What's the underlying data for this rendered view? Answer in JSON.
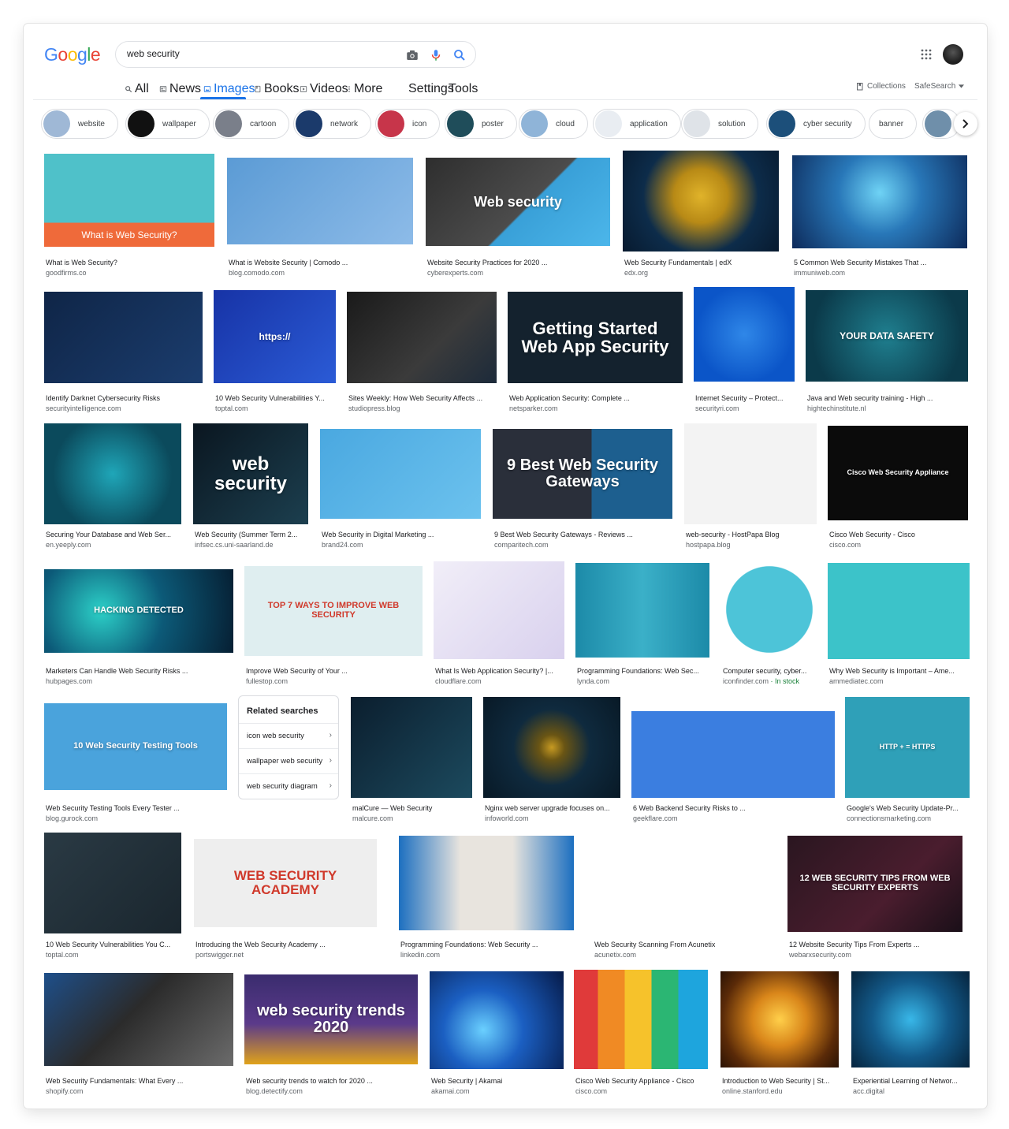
{
  "logo": {
    "letters": [
      "G",
      "o",
      "o",
      "g",
      "l",
      "e"
    ],
    "colors": [
      "#4285f4",
      "#ea4335",
      "#fbbc05",
      "#4285f4",
      "#34a853",
      "#ea4335"
    ]
  },
  "search": {
    "query": "web security",
    "camera_icon": "camera-icon",
    "mic_icon": "mic-icon",
    "search_icon": "search-icon"
  },
  "tabs": [
    {
      "label": "All",
      "icon": "search-icon"
    },
    {
      "label": "News",
      "icon": "news-icon"
    },
    {
      "label": "Images",
      "icon": "image-icon",
      "active": true
    },
    {
      "label": "Books",
      "icon": "book-icon"
    },
    {
      "label": "Videos",
      "icon": "video-icon"
    },
    {
      "label": "More",
      "icon": "more-vert-icon"
    },
    {
      "label": "Settings"
    },
    {
      "label": "Tools"
    }
  ],
  "right_links": {
    "collections": "Collections",
    "safesearch": "SafeSearch"
  },
  "chips": [
    {
      "label": "website",
      "color": "#9fb8d6"
    },
    {
      "label": "wallpaper",
      "color": "#111111"
    },
    {
      "label": "cartoon",
      "color": "#7a7f8a"
    },
    {
      "label": "network",
      "color": "#1b3a6b"
    },
    {
      "label": "icon",
      "color": "#c7354a"
    },
    {
      "label": "poster",
      "color": "#1f4d5a"
    },
    {
      "label": "cloud",
      "color": "#8fb4d8"
    },
    {
      "label": "application",
      "color": "#e9edf2"
    },
    {
      "label": "solution",
      "color": "#dfe3e8"
    },
    {
      "label": "cyber security",
      "color": "#1c4f7a"
    },
    {
      "label": "banner",
      "color": "#ffffff"
    },
    {
      "label": "",
      "color": "#6f8faa"
    }
  ],
  "results": [
    {
      "caption": "What is Web Security?",
      "source": "goodfirms.co",
      "text": "What is Web Security?",
      "bg": "linear-gradient(180deg,#4fc1c9 0%,#4fc1c9 74%,#ef6a3a 74%,#ef6a3a 100%)"
    },
    {
      "caption": "What is Website Security | Comodo ...",
      "source": "blog.comodo.com",
      "text": "",
      "bg": "linear-gradient(135deg,#5b9bd5,#8dbbe8)"
    },
    {
      "caption": "Website Security Practices for 2020 ...",
      "source": "cyberexperts.com",
      "text": "Web security",
      "bg": "linear-gradient(135deg,#2e2e2e,#4c4c4c 55%,#39a0d8 56%,#4cb6ea 100%)"
    },
    {
      "caption": "Web Security Fundamentals | edX",
      "source": "edx.org",
      "text": "",
      "bg": "radial-gradient(circle at 50% 45%,#e0b32a 0,#b88a16 28%,#0d2c4a 60%,#071a2f 100%)"
    },
    {
      "caption": "5 Common Web Security Mistakes That ...",
      "source": "immuniweb.com",
      "text": "",
      "bg": "radial-gradient(circle at 50% 40%,#6fd3f5 0,#2877b8 40%,#0d2a5a 100%)"
    },
    {
      "caption": "Identify Darknet Cybersecurity Risks",
      "source": "securityintelligence.com",
      "text": "",
      "bg": "linear-gradient(135deg,#0f2547,#1b3d6e)"
    },
    {
      "caption": "10 Web Security Vulnerabilities Y...",
      "source": "toptal.com",
      "text": "https://",
      "bg": "linear-gradient(135deg,#1733a6,#2b5bd6)"
    },
    {
      "caption": "Sites Weekly: How Web Security Affects ...",
      "source": "studiopress.blog",
      "text": "",
      "bg": "linear-gradient(135deg,#1a1a1a,#3b3b3b 60%,#1c2a3a)"
    },
    {
      "caption": "Web Application Security: Complete ...",
      "source": "netsparker.com",
      "text": "Getting Started Web App Security",
      "bg": "#14222e"
    },
    {
      "caption": "Internet Security – Protect...",
      "source": "securityri.com",
      "text": "",
      "bg": "radial-gradient(circle,#2f87e8 0,#0b55c8 70%)"
    },
    {
      "caption": "Java and Web security training - High ...",
      "source": "hightechinstitute.nl",
      "text": "YOUR DATA SAFETY",
      "bg": "radial-gradient(circle,#1f7f8f 0,#0b3a4a 80%)"
    },
    {
      "caption": "Securing Your Database and Web Ser...",
      "source": "en.yeeply.com",
      "text": "",
      "bg": "radial-gradient(circle,#1fa6b8 0,#0b4a5c 70%)"
    },
    {
      "caption": "Web Security (Summer Term 2...",
      "source": "infsec.cs.uni-saarland.de",
      "text": "web security",
      "bg": "linear-gradient(135deg,#0a1620,#1c3f4f)"
    },
    {
      "caption": "Web Security in Digital Marketing ...",
      "source": "brand24.com",
      "text": "",
      "bg": "linear-gradient(135deg,#4aa8e0,#6cc2ee)"
    },
    {
      "caption": "9 Best Web Security Gateways - Reviews ...",
      "source": "comparitech.com",
      "text": "9 Best Web Security Gateways",
      "bg": "linear-gradient(90deg,#2a2f3a 0,#2a2f3a 55%,#1d5f8f 55%,#1d5f8f 100%)"
    },
    {
      "caption": "web-security - HostPapa Blog",
      "source": "hostpapa.blog",
      "text": "",
      "bg": "#f3f3f3"
    },
    {
      "caption": "Cisco Web Security - Cisco",
      "source": "cisco.com",
      "text": "Cisco Web Security Appliance",
      "bg": "#0b0b0b"
    },
    {
      "caption": "Marketers Can Handle Web Security Risks ...",
      "source": "hubpages.com",
      "text": "HACKING DETECTED",
      "bg": "radial-gradient(circle at 30% 50%,#2cd0c8 0,#0c5a78 45%,#061f33 100%)"
    },
    {
      "caption": "Improve Web Security of Your ...",
      "source": "fullestop.com",
      "text": "TOP 7 WAYS TO IMPROVE WEB SECURITY",
      "bg": "#dfeef0"
    },
    {
      "caption": "What Is Web Application Security? |...",
      "source": "cloudflare.com",
      "text": "",
      "bg": "linear-gradient(135deg,#f1eef8,#d9d1ee)"
    },
    {
      "caption": "Programming Foundations: Web Sec...",
      "source": "lynda.com",
      "text": "",
      "bg": "linear-gradient(90deg,#1c8aa8,#3bb0c8 50%,#1c8aa8)"
    },
    {
      "caption": "Computer security, cyber...",
      "source": "iconfinder.com",
      "stock": " · In stock",
      "text": "",
      "bg": "radial-gradient(circle,#4dc4d8 0,#4dc4d8 62%,#ffffff 63%)"
    },
    {
      "caption": "Why Web Security is Important – Ame...",
      "source": "ammediatec.com",
      "text": "",
      "bg": "#3cc3c9"
    },
    {
      "caption": "Web Security Testing Tools Every Tester ...",
      "source": "blog.gurock.com",
      "text": "10 Web Security Testing Tools",
      "bg": "#4aa3dc"
    },
    {
      "caption": "malCure — Web Security",
      "source": "malcure.com",
      "text": "",
      "bg": "linear-gradient(135deg,#0b1e2e,#1c4a5e)"
    },
    {
      "caption": "Nginx web server upgrade focuses on...",
      "source": "infoworld.com",
      "text": "",
      "bg": "radial-gradient(circle,#c79a22 0,#6a5514 15%,#0f2a3e 45%,#081926 100%)"
    },
    {
      "caption": "6 Web Backend Security Risks to ...",
      "source": "geekflare.com",
      "text": "",
      "bg": "#3b7ee0"
    },
    {
      "caption": "Google's Web Security Update-Pr...",
      "source": "connectionsmarketing.com",
      "text": "HTTP + = HTTPS",
      "bg": "#2fa0b8"
    },
    {
      "caption": "10 Web Security Vulnerabilities You C...",
      "source": "toptal.com",
      "text": "",
      "bg": "linear-gradient(135deg,#2a3a44,#1a262e)"
    },
    {
      "caption": "Introducing the Web Security Academy ...",
      "source": "portswigger.net",
      "text": "WEB SECURITY ACADEMY",
      "bg": "#eeeeee"
    },
    {
      "caption": "Programming Foundations: Web Security ...",
      "source": "linkedin.com",
      "text": "",
      "bg": "linear-gradient(90deg,#1c6fc0,#e8e4de 35%,#e8e4de 65%,#1c6fc0)"
    },
    {
      "caption": "Web Security Scanning From Acunetix",
      "source": "acunetix.com",
      "text": "",
      "bg": "#ffffff"
    },
    {
      "caption": "12 Website Security Tips From Experts ...",
      "source": "webarxsecurity.com",
      "text": "12 WEB SECURITY TIPS FROM WEB SECURITY EXPERTS",
      "bg": "linear-gradient(135deg,#2a1620,#4a1d2e 60%,#1a0f18)"
    },
    {
      "caption": "Web Security Fundamentals: What Every ...",
      "source": "shopify.com",
      "text": "",
      "bg": "linear-gradient(135deg,#1e4f8a,#2b2b2b 45%,#6b6b6b)"
    },
    {
      "caption": "Web security trends to watch for 2020 ...",
      "source": "blog.detectify.com",
      "text": "web security trends 2020",
      "bg": "linear-gradient(180deg,#3a2c6e,#5b3a8a 55%,#e0a21a 100%)"
    },
    {
      "caption": "Web Security | Akamai",
      "source": "akamai.com",
      "text": "",
      "bg": "radial-gradient(circle at 40% 60%,#6ad0ff 0,#1b5fc2 40%,#061a48 100%)"
    },
    {
      "caption": "Cisco Web Security Appliance - Cisco",
      "source": "cisco.com",
      "text": "",
      "bg": "linear-gradient(90deg,#e03a3a 0,#e03a3a 18%,#f08a24 18%,#f08a24 38%,#f6c22b 38%,#f6c22b 58%,#2bb673 58%,#2bb673 78%,#1ea5dd 78%)"
    },
    {
      "caption": "Introduction to Web Security | St...",
      "source": "online.stanford.edu",
      "text": "",
      "bg": "radial-gradient(circle,#ffcf4a 0,#d9861a 35%,#5a2a08 75%,#2a1204 100%)"
    },
    {
      "caption": "Experiential Learning of Networ...",
      "source": "acc.digital",
      "text": "",
      "bg": "radial-gradient(circle,#38b7e8 0,#135a8a 50%,#06243d 100%)"
    }
  ],
  "related": {
    "title": "Related searches",
    "items": [
      "icon web security",
      "wallpaper web security",
      "web security diagram"
    ]
  }
}
